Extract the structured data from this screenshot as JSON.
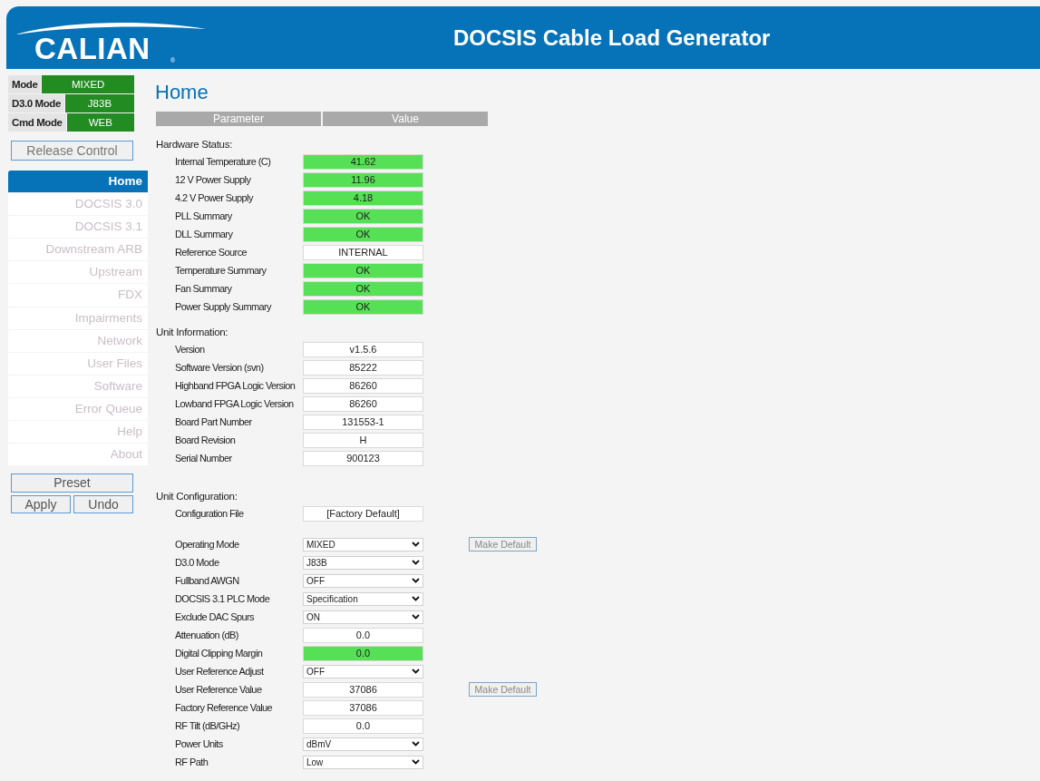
{
  "header": {
    "logo": "CALIAN",
    "logo_mark": "®",
    "title": "DOCSIS Cable Load Generator"
  },
  "status": [
    {
      "label": "Mode",
      "value": "MIXED"
    },
    {
      "label": "D3.0 Mode",
      "value": "J83B"
    },
    {
      "label": "Cmd Mode",
      "value": "WEB"
    }
  ],
  "release_button": "Release Control",
  "nav": [
    {
      "label": "Home",
      "selected": true
    },
    {
      "label": "DOCSIS 3.0",
      "selected": false
    },
    {
      "label": "DOCSIS 3.1",
      "selected": false
    },
    {
      "label": "Downstream ARB",
      "selected": false
    },
    {
      "label": "Upstream",
      "selected": false
    },
    {
      "label": "FDX",
      "selected": false
    },
    {
      "label": "Impairments",
      "selected": false
    },
    {
      "label": "Network",
      "selected": false
    },
    {
      "label": "User Files",
      "selected": false
    },
    {
      "label": "Software",
      "selected": false
    },
    {
      "label": "Error Queue",
      "selected": false
    },
    {
      "label": "Help",
      "selected": false
    },
    {
      "label": "About",
      "selected": false
    }
  ],
  "buttons": {
    "preset": "Preset",
    "apply": "Apply",
    "undo": "Undo"
  },
  "page_title": "Home",
  "table": {
    "columns": [
      "Parameter",
      "Value"
    ]
  },
  "sections": [
    {
      "title": "Hardware Status:",
      "rows": [
        {
          "label": "Internal Temperature (C)",
          "kind": "box",
          "value": "41.62",
          "ok": true
        },
        {
          "label": "12 V Power Supply",
          "kind": "box",
          "value": "11.96",
          "ok": true
        },
        {
          "label": "4.2 V Power Supply",
          "kind": "box",
          "value": "4.18",
          "ok": true
        },
        {
          "label": "PLL Summary",
          "kind": "box",
          "value": "OK",
          "ok": true
        },
        {
          "label": "DLL Summary",
          "kind": "box",
          "value": "OK",
          "ok": true
        },
        {
          "label": "Reference Source",
          "kind": "box",
          "value": "INTERNAL",
          "ok": false
        },
        {
          "label": "Temperature Summary",
          "kind": "box",
          "value": "OK",
          "ok": true
        },
        {
          "label": "Fan Summary",
          "kind": "box",
          "value": "OK",
          "ok": true
        },
        {
          "label": "Power Supply Summary",
          "kind": "box",
          "value": "OK",
          "ok": true
        }
      ]
    },
    {
      "title": "Unit Information:",
      "rows": [
        {
          "label": "Version",
          "kind": "box",
          "value": "v1.5.6",
          "ok": false
        },
        {
          "label": "Software Version (svn)",
          "kind": "box",
          "value": "85222",
          "ok": false
        },
        {
          "label": "Highband FPGA Logic Version",
          "kind": "box",
          "value": "86260",
          "ok": false
        },
        {
          "label": "Lowband FPGA Logic Version",
          "kind": "box",
          "value": "86260",
          "ok": false
        },
        {
          "label": "Board Part Number",
          "kind": "box",
          "value": "131553-1",
          "ok": false
        },
        {
          "label": "Board Revision",
          "kind": "box",
          "value": "H",
          "ok": false
        },
        {
          "label": "Serial Number",
          "kind": "box",
          "value": "900123",
          "ok": false
        }
      ]
    },
    {
      "title": "Unit Configuration:",
      "rows": [
        {
          "label": "Configuration File",
          "kind": "box",
          "value": "[Factory Default]",
          "ok": false
        },
        {
          "kind": "gap"
        },
        {
          "label": "Operating Mode",
          "kind": "select",
          "value": "MIXED",
          "action": "Make Default"
        },
        {
          "label": "D3.0 Mode",
          "kind": "select",
          "value": "J83B"
        },
        {
          "label": "Fullband AWGN",
          "kind": "select",
          "value": "OFF"
        },
        {
          "label": "DOCSIS 3.1 PLC Mode",
          "kind": "select",
          "value": "Specification"
        },
        {
          "label": "Exclude DAC Spurs",
          "kind": "select",
          "value": "ON"
        },
        {
          "label": "Attenuation (dB)",
          "kind": "box",
          "value": "0.0",
          "ok": false
        },
        {
          "label": "Digital Clipping Margin",
          "kind": "box",
          "value": "0.0",
          "ok": true
        },
        {
          "label": "User Reference Adjust",
          "kind": "select",
          "value": "OFF"
        },
        {
          "label": "User Reference Value",
          "kind": "box",
          "value": "37086",
          "ok": false,
          "action": "Make Default"
        },
        {
          "label": "Factory Reference Value",
          "kind": "box",
          "value": "37086",
          "ok": false
        },
        {
          "label": "RF Tilt (dB/GHz)",
          "kind": "box",
          "value": "0.0",
          "ok": false
        },
        {
          "label": "Power Units",
          "kind": "select",
          "value": "dBmV"
        },
        {
          "label": "RF Path",
          "kind": "select",
          "value": "Low"
        }
      ]
    }
  ]
}
